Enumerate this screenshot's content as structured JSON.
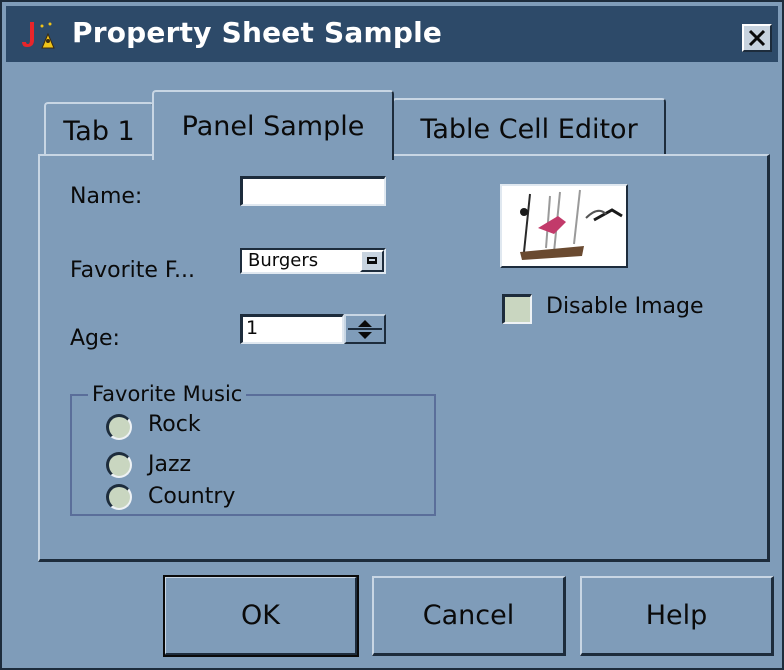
{
  "window": {
    "title": "Property Sheet Sample",
    "app_icon": "java-duke-icon",
    "close_icon": "close-icon"
  },
  "tabs": [
    {
      "label": "Tab 1",
      "selected": false
    },
    {
      "label": "Panel Sample",
      "selected": true
    },
    {
      "label": "Table Cell Editor",
      "selected": false
    }
  ],
  "panel": {
    "name_label": "Name:",
    "name_value": "",
    "food_label": "Favorite F...",
    "food_value": "Burgers",
    "age_label": "Age:",
    "age_value": "1",
    "music_group": {
      "title": "Favorite Music",
      "options": [
        "Rock",
        "Jazz",
        "Country"
      ]
    },
    "disable_image_label": "Disable Image",
    "disable_image_checked": false,
    "image_icon": "music-notes-image"
  },
  "buttons": {
    "ok": "OK",
    "cancel": "Cancel",
    "help": "Help"
  },
  "colors": {
    "background": "#7f9cb9",
    "titlebar": "#2d4a69",
    "control_fill": "#c9d6c0"
  }
}
